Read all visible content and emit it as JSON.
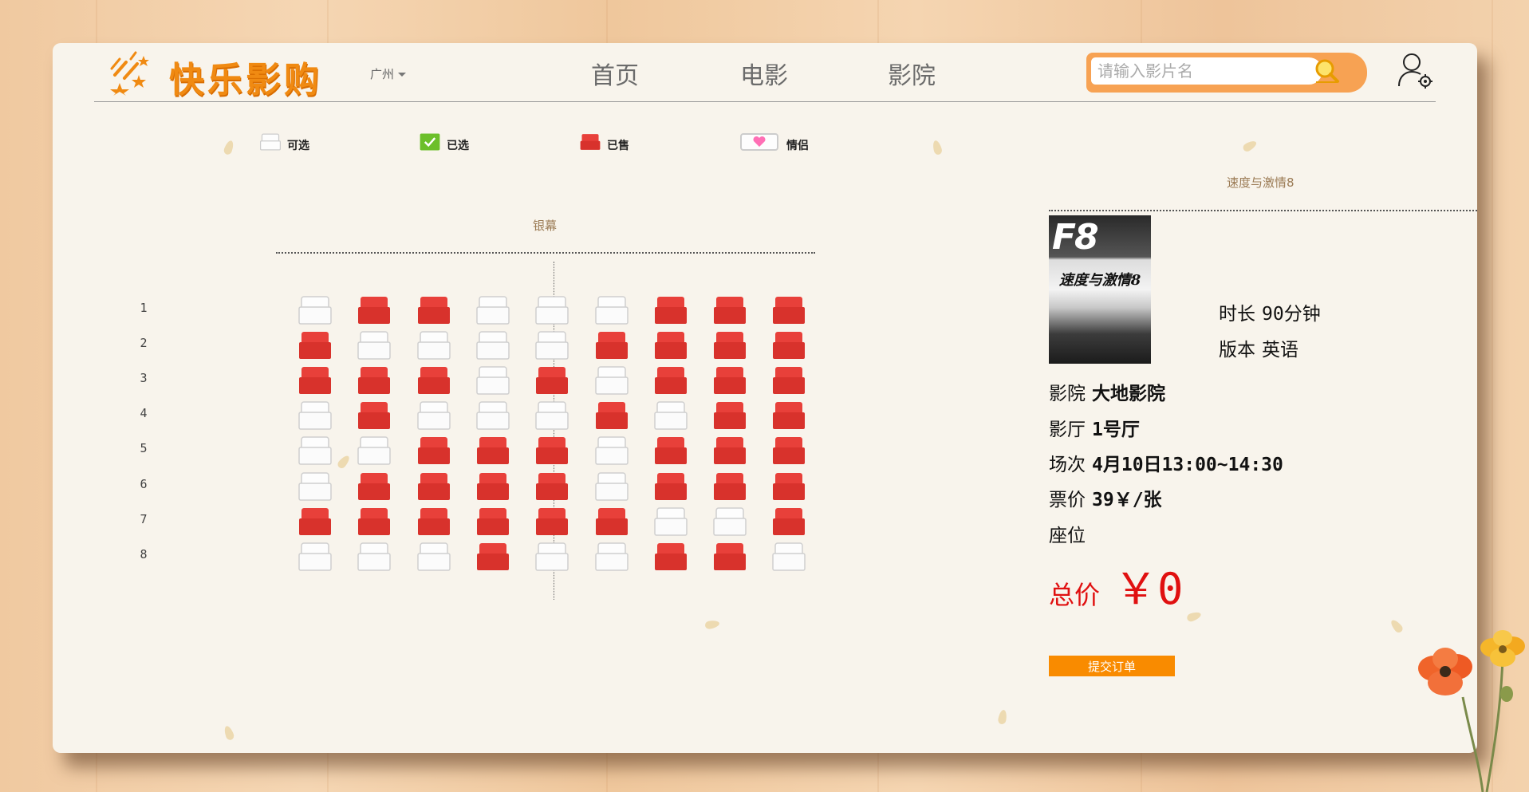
{
  "header": {
    "logo_text": "快乐影购",
    "city": "广州",
    "nav": [
      "首页",
      "电影",
      "影院"
    ],
    "search_placeholder": "请输入影片名"
  },
  "legend": {
    "available": "可选",
    "selected": "已选",
    "sold": "已售",
    "couple": "情侣"
  },
  "screen_label": "银幕",
  "seat_map": {
    "row_labels": [
      "1",
      "2",
      "3",
      "4",
      "5",
      "6",
      "7",
      "8"
    ],
    "rows": [
      [
        0,
        1,
        1,
        0,
        0,
        0,
        1,
        1,
        1
      ],
      [
        1,
        0,
        0,
        0,
        0,
        1,
        1,
        1,
        1
      ],
      [
        1,
        1,
        1,
        0,
        1,
        0,
        1,
        1,
        1
      ],
      [
        0,
        1,
        0,
        0,
        0,
        1,
        0,
        1,
        1
      ],
      [
        0,
        0,
        1,
        1,
        1,
        0,
        1,
        1,
        1
      ],
      [
        0,
        1,
        1,
        1,
        1,
        0,
        1,
        1,
        1
      ],
      [
        1,
        1,
        1,
        1,
        1,
        1,
        0,
        0,
        1
      ],
      [
        0,
        0,
        0,
        1,
        0,
        0,
        1,
        1,
        0
      ]
    ],
    "legend_codes": {
      "0": "可选",
      "1": "已售"
    }
  },
  "order": {
    "movie_title": "速度与激情8",
    "poster_title": "速度与激情8",
    "duration_label": "时长",
    "duration_value": "90分钟",
    "version_label": "版本",
    "version_value": "英语",
    "cinema_label": "影院",
    "cinema_value": "大地影院",
    "hall_label": "影厅",
    "hall_value": "1号厅",
    "session_label": "场次",
    "session_value": "4月10日13:00~14:30",
    "price_label": "票价",
    "price_value": "39￥/张",
    "seat_label": "座位",
    "seat_value": "",
    "total_label": "总价",
    "total_value": "￥0",
    "submit_label": "提交订单"
  },
  "colors": {
    "brand_orange": "#f08a12",
    "seat_sold": "#e8403a",
    "seat_selected": "#6cbf2a",
    "total_red": "#e01010",
    "submit_bg": "#f98b00"
  }
}
